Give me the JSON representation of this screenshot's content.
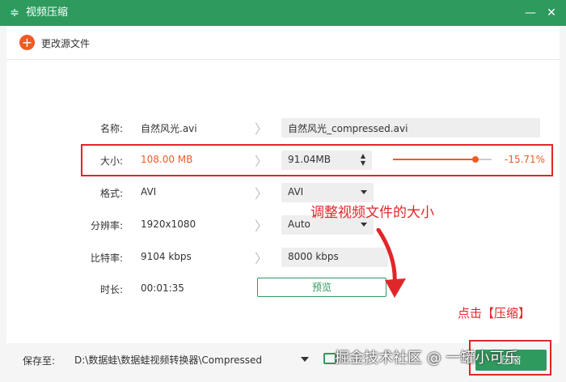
{
  "window": {
    "title": "视频压缩",
    "logo": "≑",
    "minimize": "—",
    "close": "✕"
  },
  "toolbar": {
    "change_source_label": "更改源文件",
    "add_icon": "+"
  },
  "rows": {
    "name": {
      "label": "名称:",
      "source": "自然风光.avi",
      "target": "自然风光_compressed.avi"
    },
    "size": {
      "label": "大小:",
      "source": "108.00 MB",
      "target": "91.04MB",
      "ratio": "-15.71%",
      "slider_fraction": 0.84
    },
    "format": {
      "label": "格式:",
      "source": "AVI",
      "target": "AVI"
    },
    "resolution": {
      "label": "分辨率:",
      "source": "1920x1080",
      "target": "Auto"
    },
    "bitrate": {
      "label": "比特率:",
      "source": "9104 kbps",
      "target": "8000 kbps"
    },
    "duration": {
      "label": "时长:",
      "source": "00:01:35"
    }
  },
  "chevron": "〉",
  "stepper": {
    "up": "▲",
    "down": "▼"
  },
  "preview_label": "预览",
  "annotations": {
    "adjust": "调整视频文件的大小",
    "click_compress": "点击【压缩】"
  },
  "footer": {
    "save_label": "保存至:",
    "path": "D:\\数据蛙\\数据蛙视频转换器\\Compressed",
    "compress_label": "压缩"
  },
  "watermark": "掘金技术社区 @ 一罐小可乐",
  "colors": {
    "brand_green": "#2e9a5e",
    "accent_orange": "#f05a24",
    "annotation_red": "#e0262a"
  }
}
